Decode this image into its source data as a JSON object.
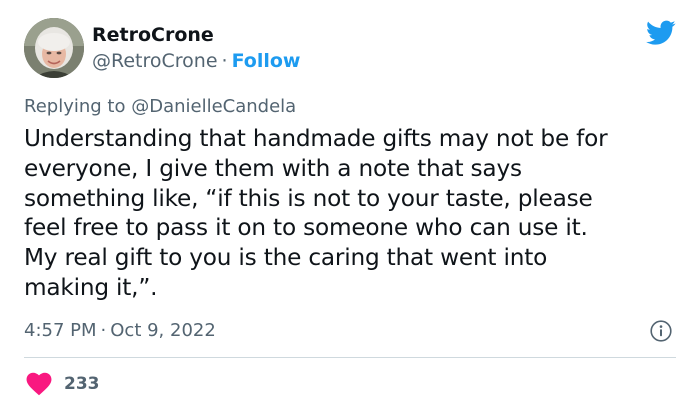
{
  "author": {
    "display_name": "RetroCrone",
    "handle": "@RetroCrone",
    "separator": "·",
    "follow_label": "Follow"
  },
  "reply": {
    "prefix": "Replying to",
    "mention": "@DanielleCandela"
  },
  "tweet": {
    "lines": [
      "Understanding that handmade gifts may not be for",
      "everyone, I give them with a note that says",
      "something like, “if this is not to your taste, please",
      "feel free to pass it on to someone who can use it.",
      "My real gift to you is the caring that went into",
      "making it,”."
    ]
  },
  "meta": {
    "time": "4:57 PM",
    "separator": "·",
    "date": "Oct 9, 2022"
  },
  "engagement": {
    "likes": "233"
  },
  "icons": {
    "brand": "twitter-bird-icon",
    "info": "info-icon",
    "like": "heart-icon"
  },
  "colors": {
    "brand_blue": "#1d9bf0",
    "text_primary": "#0f1419",
    "text_secondary": "#536471",
    "heart": "#f91880",
    "divider": "#cfd9de"
  }
}
